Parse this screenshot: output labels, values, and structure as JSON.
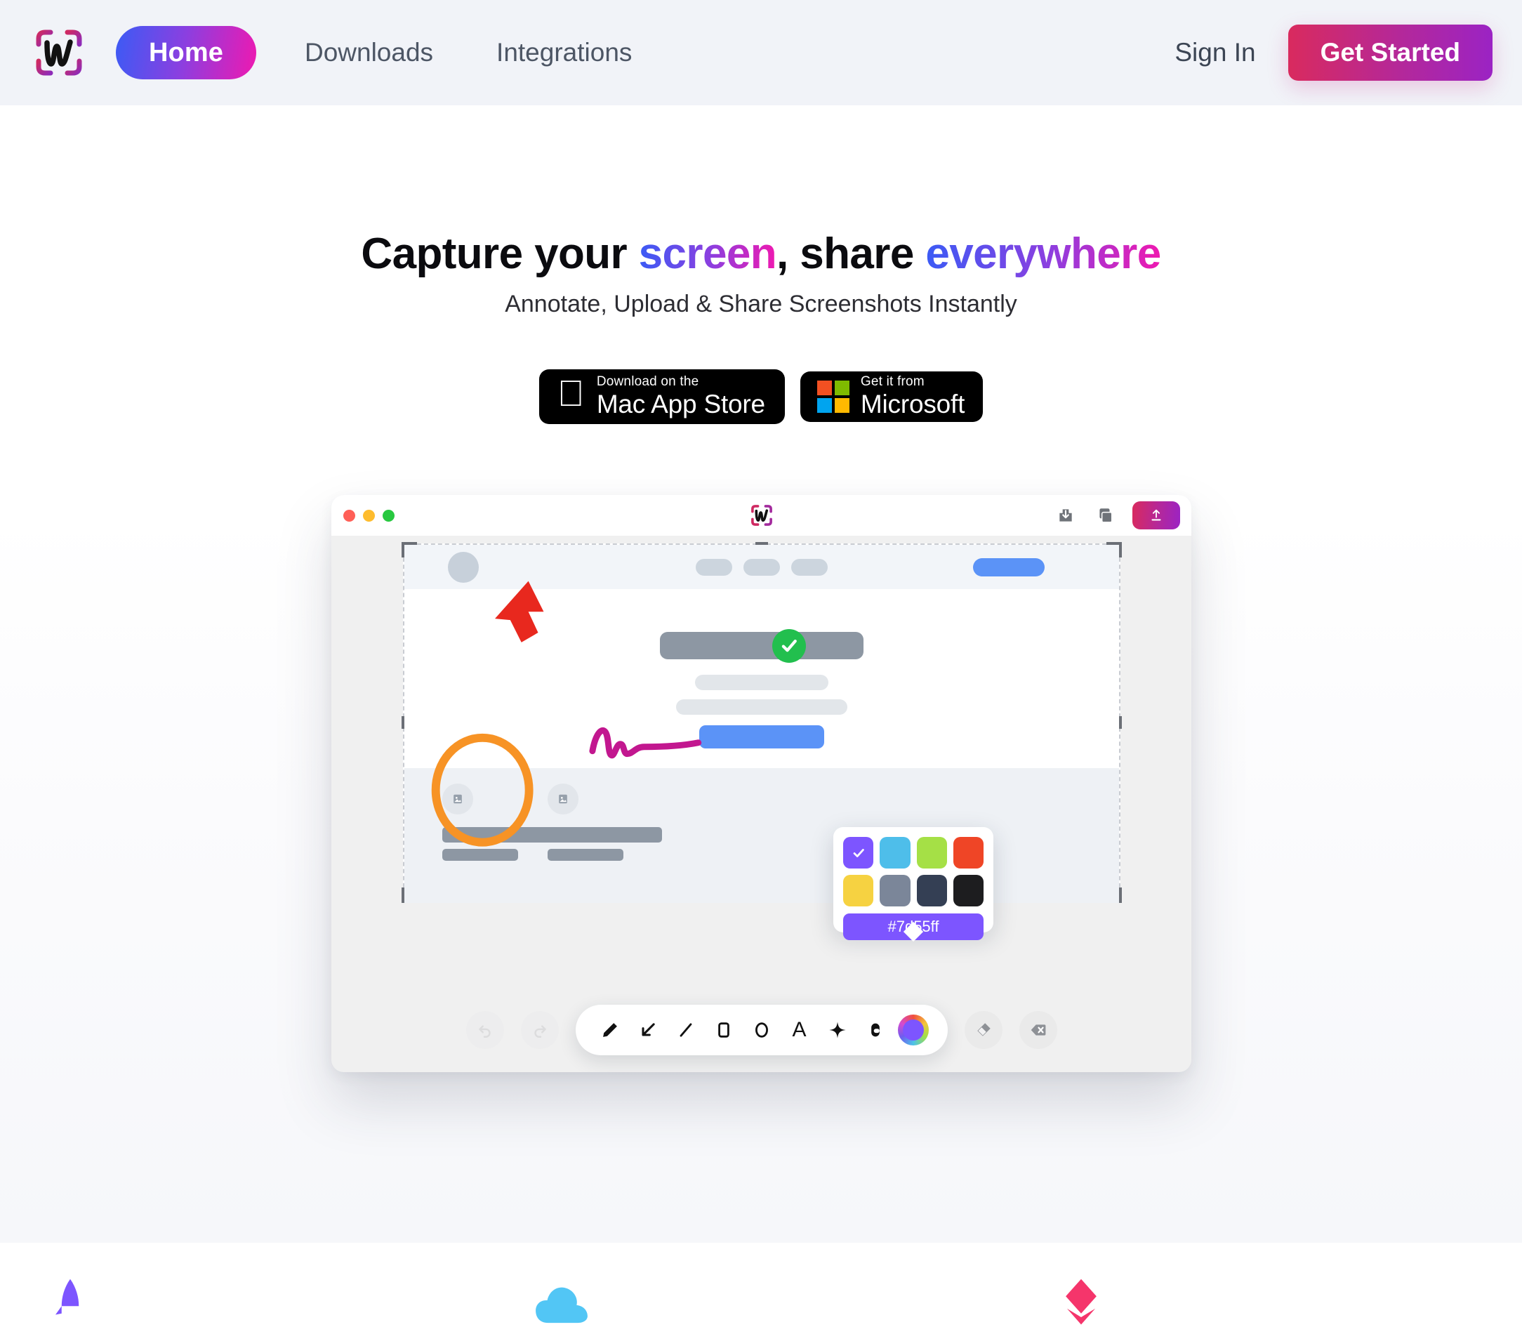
{
  "header": {
    "logo_icon": "wuzzy-brand-logo",
    "nav": [
      {
        "label": "Home",
        "active": true
      },
      {
        "label": "Downloads",
        "active": false
      },
      {
        "label": "Integrations",
        "active": false
      }
    ],
    "sign_in_label": "Sign In",
    "get_started_label": "Get Started",
    "background_color": "#f1f3f8",
    "accent_gradient_start": "#3b5bf5",
    "accent_gradient_end": "#ef19b0",
    "cta_gradient_start": "#d92a5e",
    "cta_gradient_end": "#9b23c4"
  },
  "hero": {
    "title_part1": "Capture your ",
    "title_highlight1": "screen",
    "title_part2": ", share ",
    "title_highlight2": "everywhere",
    "subtitle": "Annotate, Upload & Share Screenshots Instantly",
    "badges": [
      {
        "small": "Download on the",
        "big": "Mac App Store",
        "icon": "apple-icon"
      },
      {
        "small": "Get it from",
        "big": "Microsoft",
        "icon": "microsoft-squares-icon"
      }
    ],
    "microsoft_square_colors": [
      "#f25022",
      "#7fba00",
      "#00a4ef",
      "#ffb900"
    ]
  },
  "app_window": {
    "traffic_lights": [
      "#ff5f57",
      "#febc2e",
      "#28c840"
    ],
    "logo_icon": "wuzzy-brand-logo",
    "actions": [
      {
        "name": "download-icon",
        "label": "Download"
      },
      {
        "name": "copy-icon",
        "label": "Copy"
      },
      {
        "name": "upload-button",
        "label": "Upload"
      }
    ],
    "canvas": {
      "selection_handles": 8,
      "annotations": [
        {
          "type": "arrow",
          "color": "#e8281e",
          "name": "red-arrow-annotation"
        },
        {
          "type": "ellipse",
          "color": "#f79325",
          "name": "orange-circle-annotation"
        },
        {
          "type": "freehand",
          "color": "#c2178f",
          "name": "magenta-scribble-annotation"
        },
        {
          "type": "badge",
          "color": "#22bf4e",
          "name": "green-check-annotation",
          "glyph": "✓"
        }
      ],
      "mock_pill_widths": [
        52,
        52,
        52
      ]
    },
    "color_popup": {
      "swatches": [
        {
          "hex": "#7d55ff",
          "selected": true
        },
        {
          "hex": "#4ebeea",
          "selected": false
        },
        {
          "hex": "#a5e046",
          "selected": false
        },
        {
          "hex": "#ef4526",
          "selected": false
        },
        {
          "hex": "#f6d241",
          "selected": false
        },
        {
          "hex": "#7b8699",
          "selected": false
        },
        {
          "hex": "#343f54",
          "selected": false
        },
        {
          "hex": "#1d1d1f",
          "selected": false
        }
      ],
      "hex_value": "#7d55ff",
      "check_glyph": "✓"
    },
    "toolbar": {
      "history": [
        {
          "name": "undo-button",
          "label": "Undo",
          "enabled": false
        },
        {
          "name": "redo-button",
          "label": "Redo",
          "enabled": false
        }
      ],
      "tools": [
        {
          "name": "pencil-tool",
          "label": "Pencil"
        },
        {
          "name": "arrow-tool",
          "label": "Arrow"
        },
        {
          "name": "line-tool",
          "label": "Line"
        },
        {
          "name": "rectangle-tool",
          "label": "Rectangle"
        },
        {
          "name": "ellipse-tool",
          "label": "Ellipse"
        },
        {
          "name": "text-tool",
          "label": "Text",
          "glyph": "A"
        },
        {
          "name": "magic-tool",
          "label": "Magic"
        },
        {
          "name": "blur-tool",
          "label": "Blur"
        },
        {
          "name": "color-picker-tool",
          "label": "Color",
          "value": "#7d55ff"
        }
      ],
      "right_actions": [
        {
          "name": "eraser-button",
          "label": "Eraser"
        },
        {
          "name": "clear-button",
          "label": "Clear"
        }
      ]
    }
  },
  "features_peek": [
    {
      "name": "purple-rocket-icon",
      "color": "#7d55ff"
    },
    {
      "name": "blue-cloud-icon",
      "color": "#52c6f5"
    },
    {
      "name": "pink-layers-icon",
      "color": "#f5356b"
    }
  ]
}
